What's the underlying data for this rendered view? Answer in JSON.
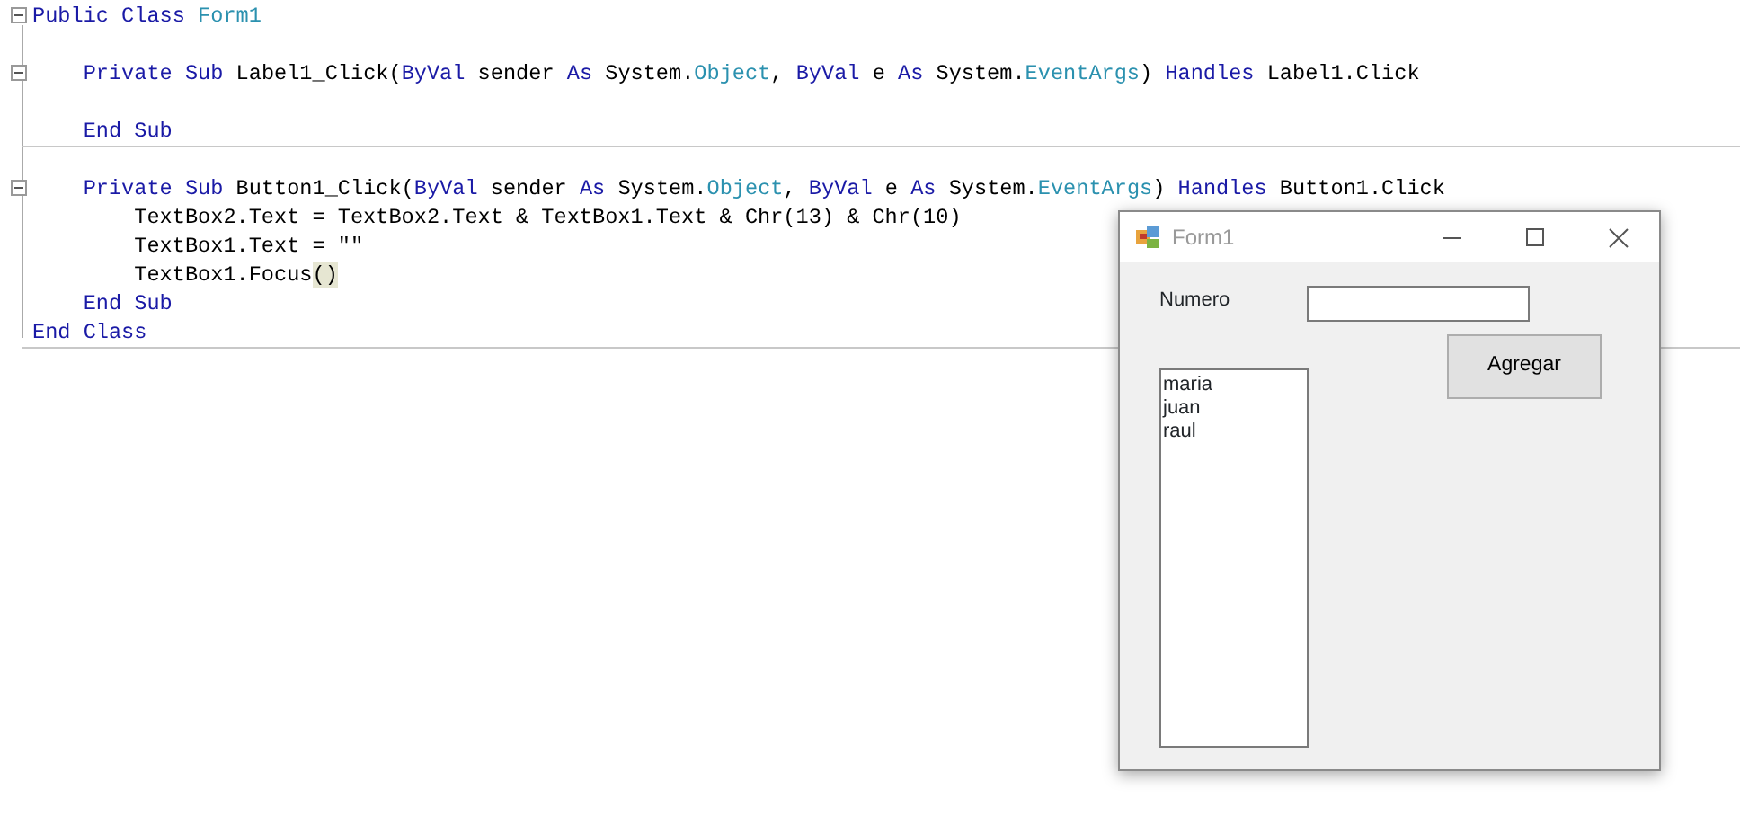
{
  "code_lines": [
    {
      "kind": "code",
      "fold": true,
      "tokens": [
        {
          "kind": "keyword",
          "text": "Public Class "
        },
        {
          "kind": "type",
          "text": "Form1"
        }
      ]
    },
    {
      "kind": "blank"
    },
    {
      "kind": "code",
      "fold": true,
      "tokens": [
        {
          "kind": "keyword",
          "text": "    Private Sub "
        },
        {
          "kind": "plain",
          "text": "Label1_Click("
        },
        {
          "kind": "keyword",
          "text": "ByVal"
        },
        {
          "kind": "plain",
          "text": " sender "
        },
        {
          "kind": "keyword",
          "text": "As"
        },
        {
          "kind": "plain",
          "text": " System."
        },
        {
          "kind": "type",
          "text": "Object"
        },
        {
          "kind": "plain",
          "text": ", "
        },
        {
          "kind": "keyword",
          "text": "ByVal"
        },
        {
          "kind": "plain",
          "text": " e "
        },
        {
          "kind": "keyword",
          "text": "As"
        },
        {
          "kind": "plain",
          "text": " System."
        },
        {
          "kind": "type",
          "text": "EventArgs"
        },
        {
          "kind": "plain",
          "text": ") "
        },
        {
          "kind": "keyword",
          "text": "Handles"
        },
        {
          "kind": "plain",
          "text": " Label1.Click"
        }
      ]
    },
    {
      "kind": "blank"
    },
    {
      "kind": "code",
      "fold": false,
      "separator": true,
      "tokens": [
        {
          "kind": "keyword",
          "text": "    End Sub"
        }
      ]
    },
    {
      "kind": "blank"
    },
    {
      "kind": "code",
      "fold": true,
      "tokens": [
        {
          "kind": "keyword",
          "text": "    Private Sub "
        },
        {
          "kind": "plain",
          "text": "Button1_Click("
        },
        {
          "kind": "keyword",
          "text": "ByVal"
        },
        {
          "kind": "plain",
          "text": " sender "
        },
        {
          "kind": "keyword",
          "text": "As"
        },
        {
          "kind": "plain",
          "text": " System."
        },
        {
          "kind": "type",
          "text": "Object"
        },
        {
          "kind": "plain",
          "text": ", "
        },
        {
          "kind": "keyword",
          "text": "ByVal"
        },
        {
          "kind": "plain",
          "text": " e "
        },
        {
          "kind": "keyword",
          "text": "As"
        },
        {
          "kind": "plain",
          "text": " System."
        },
        {
          "kind": "type",
          "text": "EventArgs"
        },
        {
          "kind": "plain",
          "text": ") "
        },
        {
          "kind": "keyword",
          "text": "Handles"
        },
        {
          "kind": "plain",
          "text": " Button1.Click"
        }
      ]
    },
    {
      "kind": "code",
      "fold": false,
      "tokens": [
        {
          "kind": "plain",
          "text": "        TextBox2.Text = TextBox2.Text & TextBox1.Text & Chr(13) & Chr(10)"
        }
      ]
    },
    {
      "kind": "code",
      "fold": false,
      "tokens": [
        {
          "kind": "plain",
          "text": "        TextBox1.Text = \"\""
        }
      ]
    },
    {
      "kind": "code",
      "fold": false,
      "tokens": [
        {
          "kind": "plain",
          "text": "        TextBox1.Focus"
        },
        {
          "kind": "match",
          "text": "()"
        }
      ]
    },
    {
      "kind": "code",
      "fold": false,
      "tokens": [
        {
          "kind": "keyword",
          "text": "    End Sub"
        }
      ]
    },
    {
      "kind": "code",
      "fold": false,
      "separator": true,
      "tokens": [
        {
          "kind": "keyword",
          "text": "End Class"
        }
      ]
    }
  ],
  "form_window": {
    "title": "Form1",
    "label": "Numero",
    "button": "Agregar",
    "listbox_lines": [
      "maria",
      "juan",
      "raul"
    ]
  }
}
